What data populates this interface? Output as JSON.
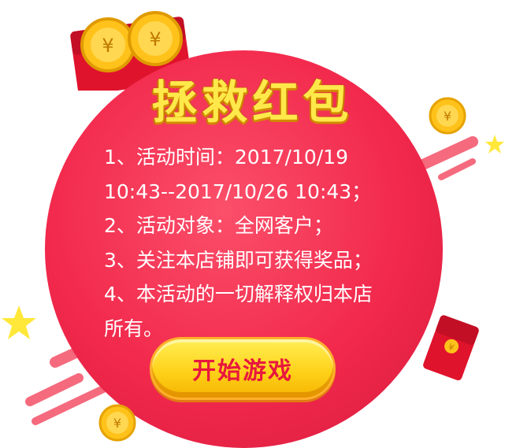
{
  "title": "拯救红包",
  "rules": [
    "1、活动时间：2017/10/19",
    "10:43--2017/10/26 10:43；",
    "2、活动对象：全网客户；",
    "3、关注本店铺即可获得奖品；",
    "4、本活动的一切解释权归本店",
    "所有。"
  ],
  "start_button": "开始游戏",
  "colors": {
    "circle": "#f2294c",
    "title": "#ffe94a",
    "button": "#ffd21a",
    "button_text": "#e8173e",
    "accent_stripe": "#f35a6e",
    "star": "#ffe83a",
    "coin": "#ffc21a"
  },
  "icons": [
    "red-envelope-icon",
    "coin-icon",
    "star-icon"
  ]
}
